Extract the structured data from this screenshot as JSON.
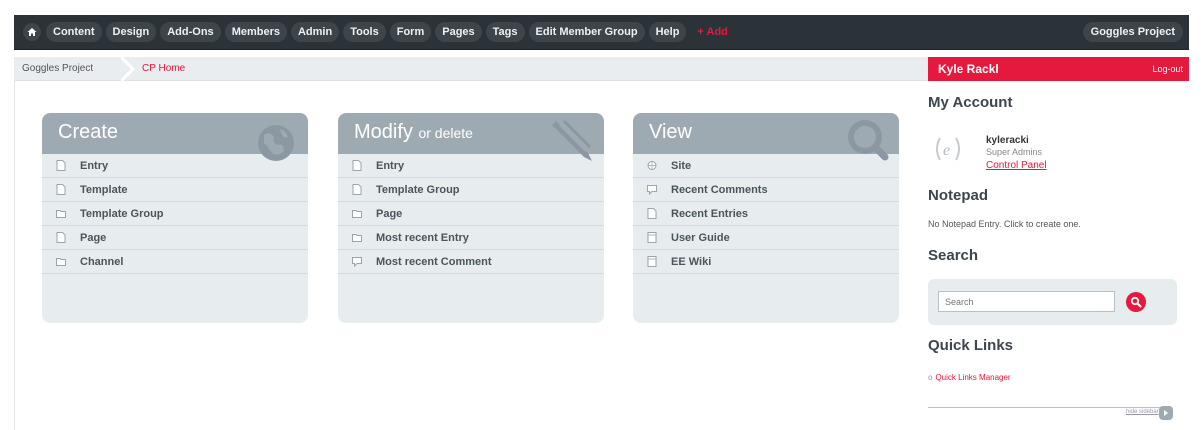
{
  "nav": {
    "items": [
      "Content",
      "Design",
      "Add-Ons",
      "Members",
      "Admin",
      "Tools",
      "Form",
      "Pages",
      "Tags",
      "Edit Member Group",
      "Help"
    ],
    "add_label": "+ Add",
    "site_name": "Goggles Project",
    "home_icon": "home-icon"
  },
  "breadcrumb": {
    "home": "Goggles Project",
    "current": "CP Home"
  },
  "panels": {
    "create": {
      "title": "Create",
      "icon": "globe-icon",
      "items": [
        {
          "label": "Entry",
          "icon": "document-icon"
        },
        {
          "label": "Template",
          "icon": "document-icon"
        },
        {
          "label": "Template Group",
          "icon": "folder-icon"
        },
        {
          "label": "Page",
          "icon": "document-icon"
        },
        {
          "label": "Channel",
          "icon": "folder-icon"
        }
      ]
    },
    "modify": {
      "title": "Modify",
      "title_suffix": "or delete",
      "icon": "pencil-icon",
      "items": [
        {
          "label": "Entry",
          "icon": "document-icon"
        },
        {
          "label": "Template Group",
          "icon": "document-icon"
        },
        {
          "label": "Page",
          "icon": "folder-icon"
        },
        {
          "label": "Most recent Entry",
          "icon": "folder-icon"
        },
        {
          "label": "Most recent Comment",
          "icon": "comment-icon"
        }
      ]
    },
    "view": {
      "title": "View",
      "icon": "magnifier-icon",
      "items": [
        {
          "label": "Site",
          "icon": "globe-small-icon"
        },
        {
          "label": "Recent Comments",
          "icon": "comment-icon"
        },
        {
          "label": "Recent Entries",
          "icon": "document-icon"
        },
        {
          "label": "User Guide",
          "icon": "book-icon"
        },
        {
          "label": "EE Wiki",
          "icon": "book-icon"
        }
      ]
    }
  },
  "sidebar": {
    "user_name": "Kyle Rackl",
    "logout": "Log-out",
    "my_account": "My Account",
    "username": "kyleracki",
    "role": "Super Admins",
    "control_panel": "Control Panel",
    "notepad_heading": "Notepad",
    "notepad_text": "No Notepad Entry. Click to create one.",
    "search_heading": "Search",
    "search_placeholder": "Search",
    "quick_links_heading": "Quick Links",
    "quick_links": [
      "Quick Links Manager"
    ],
    "hide_sidebar": "hide sidebar"
  },
  "colors": {
    "accent": "#e5183d",
    "topbar": "#2c3338",
    "panel_header": "#9eaab2",
    "panel_body": "#e7ecef"
  }
}
